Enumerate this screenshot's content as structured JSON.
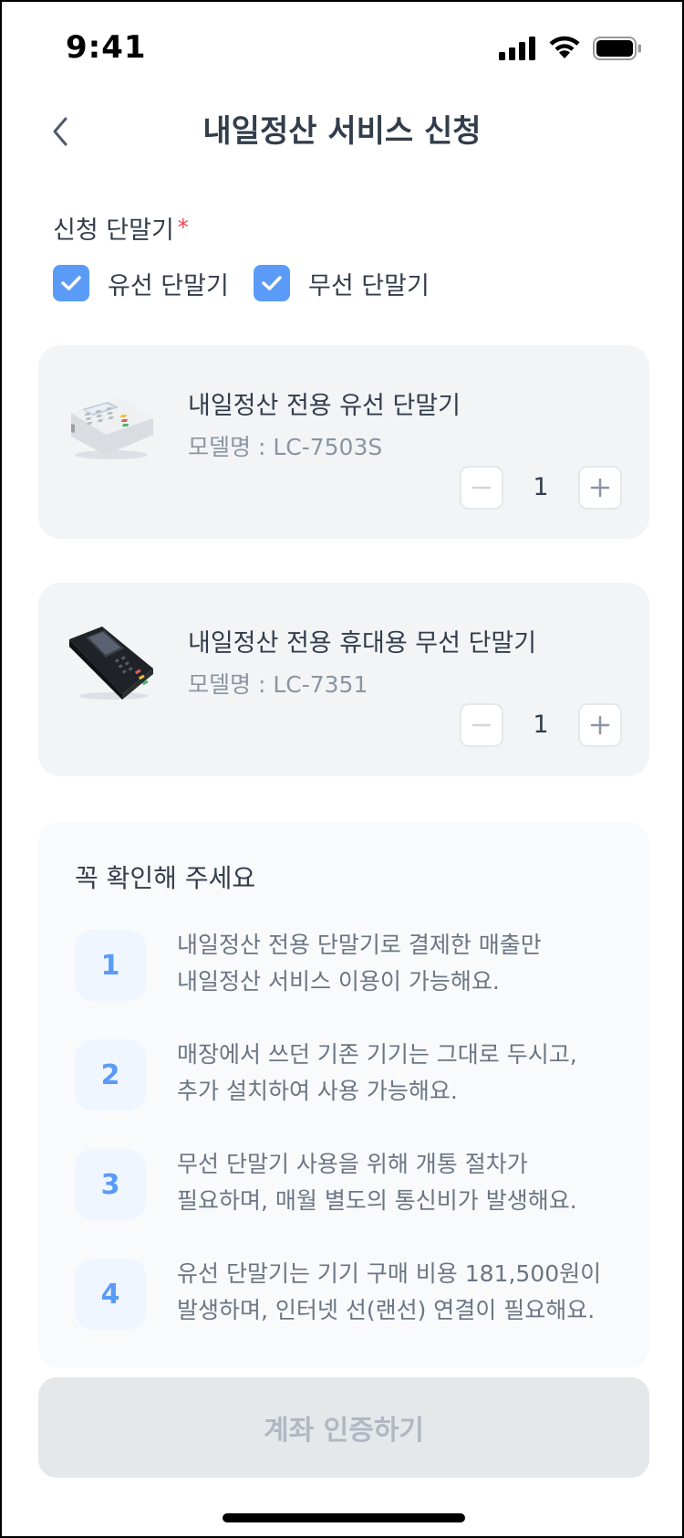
{
  "status_bar": {
    "time": "9:41"
  },
  "header": {
    "title": "내일정산 서비스 신청"
  },
  "terminal_section": {
    "label": "신청 단말기",
    "required_mark": "*",
    "options": [
      {
        "label": "유선 단말기",
        "checked": true
      },
      {
        "label": "무선 단말기",
        "checked": true
      }
    ]
  },
  "products": [
    {
      "name": "내일정산 전용 유선 단말기",
      "model": "모델명 : LC-7503S",
      "quantity": "1",
      "image": "wired-card-terminal"
    },
    {
      "name": "내일정산 전용 휴대용 무선 단말기",
      "model": "모델명 : LC-7351",
      "quantity": "1",
      "image": "wireless-card-terminal"
    }
  ],
  "notice": {
    "title": "꼭 확인해 주세요",
    "items": [
      {
        "number": "1",
        "text": "내일정산 전용 단말기로 결제한 매출만\n내일정산 서비스 이용이 가능해요."
      },
      {
        "number": "2",
        "text": "매장에서 쓰던 기존 기기는 그대로 두시고,\n추가 설치하여 사용 가능해요."
      },
      {
        "number": "3",
        "text": "무선 단말기 사용을 위해 개통 절차가\n필요하며, 매월 별도의 통신비가 발생해요."
      },
      {
        "number": "4",
        "text": "유선 단말기는 기기 구매 비용 181,500원이\n발생하며, 인터넷 선(랜선) 연결이 필요해요."
      }
    ]
  },
  "cta": {
    "label": "계좌 인증하기",
    "enabled": false
  },
  "colors": {
    "accent": "#5b9bf8",
    "required": "#f04452",
    "text_primary": "#333d4b",
    "text_secondary": "#6b7684",
    "card_bg": "#f2f4f6",
    "cta_disabled_bg": "#e5e8eb",
    "cta_disabled_text": "#b0b8c1"
  }
}
